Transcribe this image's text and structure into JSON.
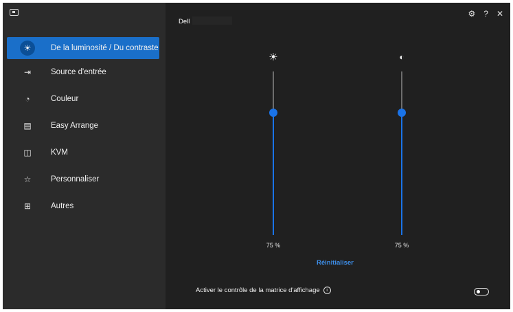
{
  "sidebar": {
    "items": [
      {
        "label": "De la luminosité / Du contraste",
        "icon": "brightness-icon",
        "glyph": "☀"
      },
      {
        "label": "Source d'entrée",
        "icon": "input-source-icon",
        "glyph": "⇥"
      },
      {
        "label": "Couleur",
        "icon": "color-palette-icon",
        "glyph": "◔"
      },
      {
        "label": "Easy Arrange",
        "icon": "easy-arrange-icon",
        "glyph": "▤"
      },
      {
        "label": "KVM",
        "icon": "kvm-icon",
        "glyph": "◫"
      },
      {
        "label": "Personnaliser",
        "icon": "star-icon",
        "glyph": "☆"
      },
      {
        "label": "Autres",
        "icon": "others-icon",
        "glyph": "⊞"
      }
    ]
  },
  "header": {
    "monitor_name": "Dell",
    "icons": {
      "settings": "⚙",
      "help": "?",
      "close": "✕"
    }
  },
  "brightness": {
    "icon": "☀",
    "value": 75,
    "label": "75 %"
  },
  "contrast": {
    "icon": "◐",
    "value": 75,
    "label": "75 %"
  },
  "reset_label": "Réinitialiser",
  "matrix": {
    "label": "Activer le contrôle de la matrice d'affichage",
    "info": "i",
    "enabled": false
  },
  "colors": {
    "accent": "#1a73e8",
    "active_item": "#1a6fc9",
    "link": "#3d8ee8"
  }
}
